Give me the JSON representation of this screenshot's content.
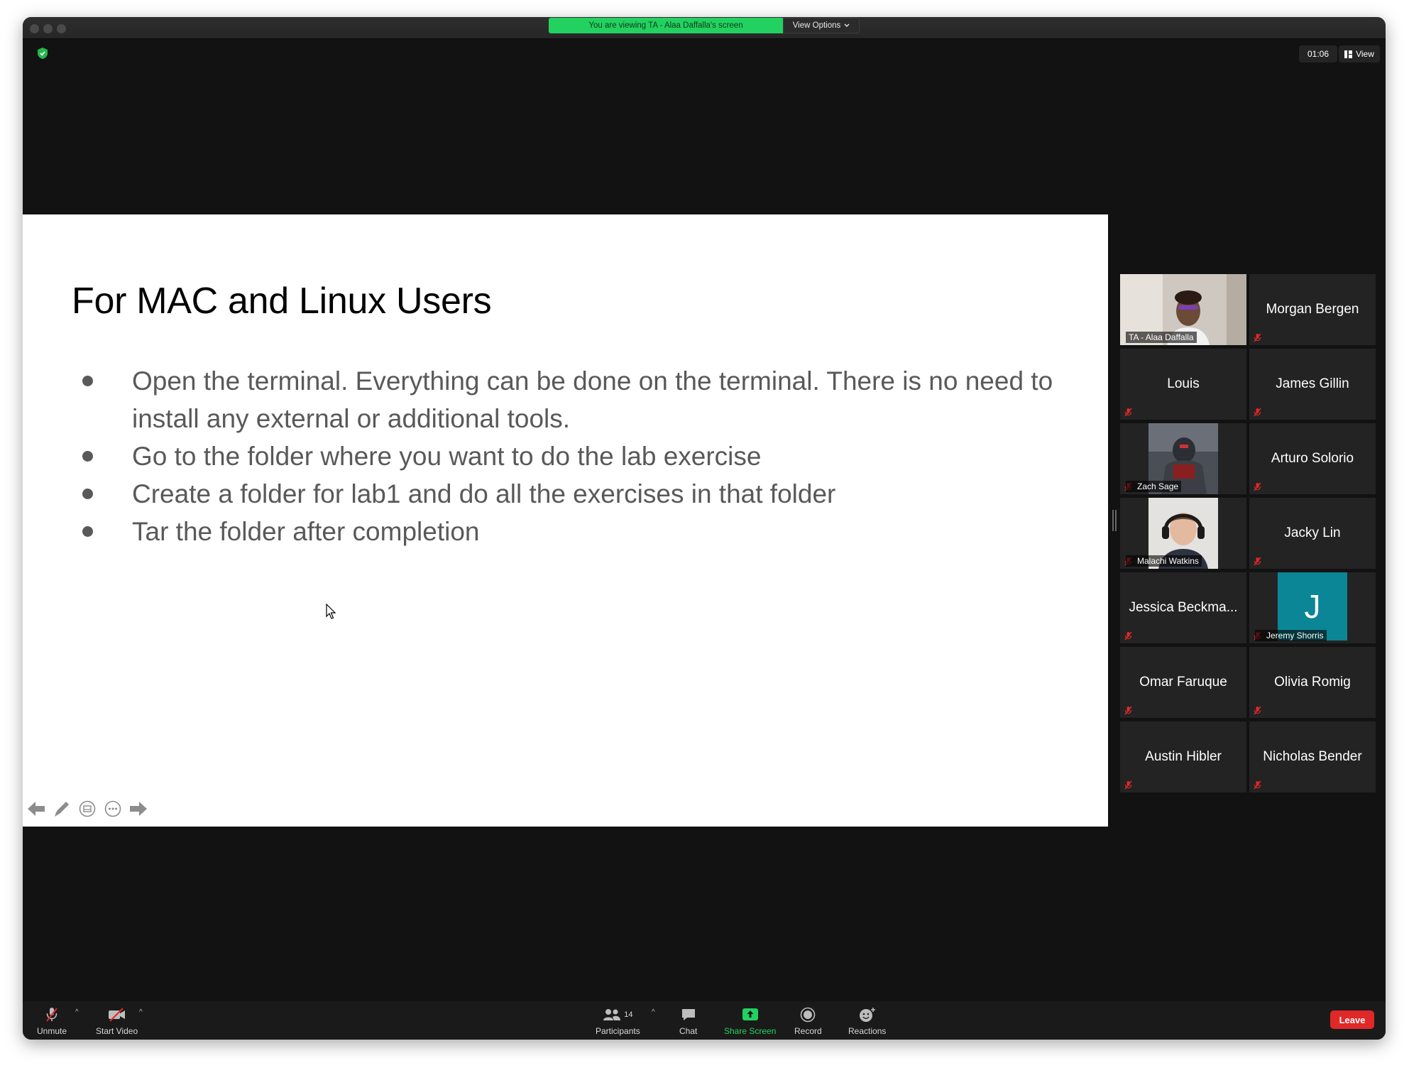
{
  "banner": {
    "viewing_text": "You are viewing TA - Alaa Daffalla's screen",
    "view_options_label": "View Options"
  },
  "topbar": {
    "timer": "01:06",
    "view_label": "View"
  },
  "slide": {
    "title": "For MAC and Linux Users",
    "bullets": [
      "Open the terminal. Everything can be done on the terminal. There is no need to install any external or additional tools.",
      "Go to the folder where you want to do the lab exercise",
      "Create a folder for lab1 and do all the exercises in that folder",
      "Tar the folder after completion"
    ]
  },
  "participants": [
    {
      "name": "TA - Alaa Daffalla",
      "video": true,
      "active": true
    },
    {
      "name": "Morgan Bergen",
      "video": false
    },
    {
      "name": "Louis",
      "video": false
    },
    {
      "name": "James Gillin",
      "video": false
    },
    {
      "name": "Zach Sage",
      "video": true
    },
    {
      "name": "Arturo Solorio",
      "video": false
    },
    {
      "name": "Malachi Watkins",
      "video": true
    },
    {
      "name": "Jacky Lin",
      "video": false
    },
    {
      "name": "Jessica Beckma...",
      "video": false
    },
    {
      "name": "Jeremy Shorris",
      "avatar_letter": "J",
      "avatar_color": "#0b8696"
    },
    {
      "name": "Omar Faruque",
      "video": false
    },
    {
      "name": "Olivia Romig",
      "video": false
    },
    {
      "name": "Austin Hibler",
      "video": false
    },
    {
      "name": "Nicholas Bender",
      "video": false
    }
  ],
  "toolbar": {
    "unmute": "Unmute",
    "start_video": "Start Video",
    "participants_label": "Participants",
    "participants_count": "14",
    "chat": "Chat",
    "share_screen": "Share Screen",
    "record": "Record",
    "reactions": "Reactions",
    "leave": "Leave"
  },
  "colors": {
    "share_green": "#23d160",
    "active_speaker": "#c3e55a",
    "leave_red": "#e02828"
  }
}
